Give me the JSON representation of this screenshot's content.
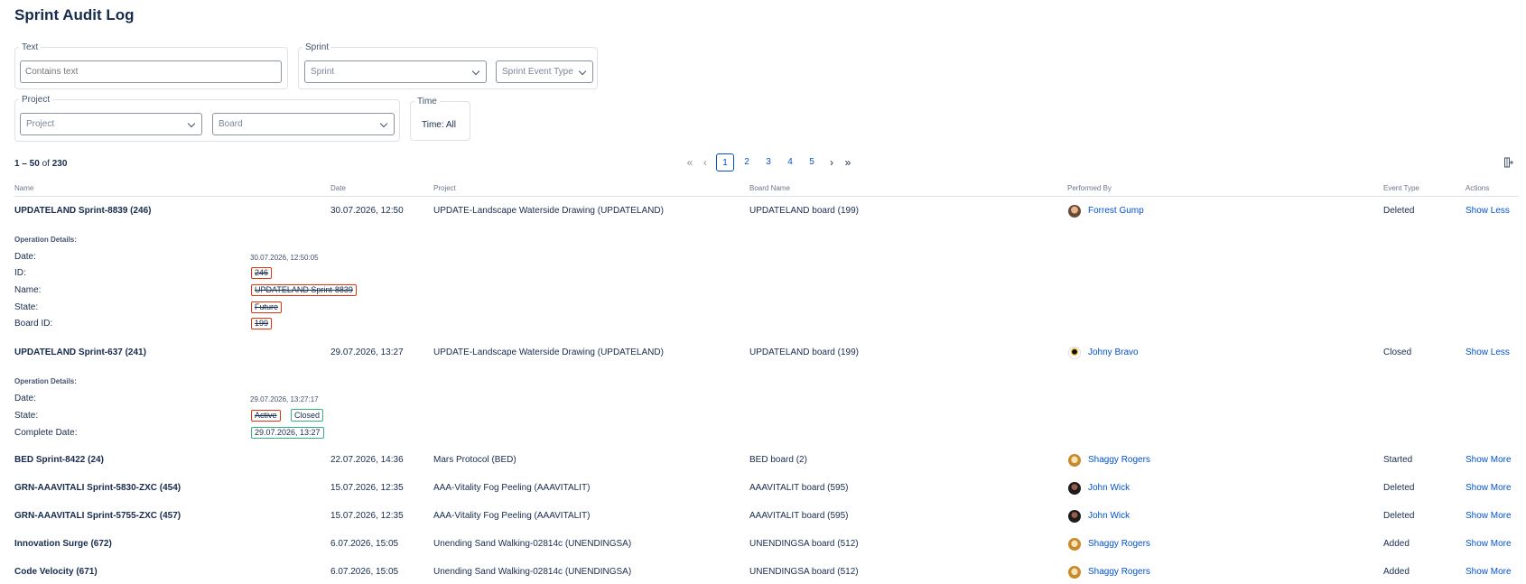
{
  "page": {
    "title": "Sprint Audit Log"
  },
  "filters": {
    "text_group": {
      "legend": "Text",
      "placeholder": "Contains text"
    },
    "sprint_group": {
      "legend": "Sprint",
      "sprint_select": "Sprint",
      "event_type_select": "Sprint Event Type"
    },
    "project_group": {
      "legend": "Project",
      "project_select": "Project",
      "board_select": "Board"
    },
    "time_group": {
      "legend": "Time",
      "value": "Time:  All"
    }
  },
  "pagination": {
    "range": "1 – 50",
    "of": "of",
    "total": "230",
    "first": "«",
    "prev": "‹",
    "next": "›",
    "last": "»",
    "pages": [
      "1",
      "2",
      "3",
      "4",
      "5"
    ],
    "current_page": 1
  },
  "table": {
    "columns": [
      "Name",
      "Date",
      "Project",
      "Board Name",
      "Performed By",
      "Event Type",
      "Actions"
    ],
    "rows": [
      {
        "name": "UPDATELAND Sprint-8839 (246)",
        "date": "30.07.2026, 12:50",
        "project": "UPDATE-Landscape Waterside Drawing (UPDATELAND)",
        "board": "UPDATELAND board (199)",
        "performer": "Forrest Gump",
        "avatar": "forrest",
        "event": "Deleted",
        "action": "Show Less",
        "details": {
          "title": "Operation Details:",
          "date_label": "Date:",
          "date_value": "30.07.2026, 12:50:05",
          "fields": [
            {
              "label": "ID:",
              "removed": "246"
            },
            {
              "label": "Name:",
              "removed": "UPDATELAND Sprint-8839"
            },
            {
              "label": "State:",
              "removed": "Future"
            },
            {
              "label": "Board ID:",
              "removed": "199"
            }
          ]
        }
      },
      {
        "name": "UPDATELAND Sprint-637 (241)",
        "date": "29.07.2026, 13:27",
        "project": "UPDATE-Landscape Waterside Drawing (UPDATELAND)",
        "board": "UPDATELAND board (199)",
        "performer": "Johny Bravo",
        "avatar": "johny",
        "event": "Closed",
        "action": "Show Less",
        "details": {
          "title": "Operation Details:",
          "date_label": "Date:",
          "date_value": "29.07.2026, 13:27:17",
          "fields": [
            {
              "label": "State:",
              "removed": "Active",
              "added": "Closed"
            },
            {
              "label": "Complete Date:",
              "added": "29.07.2026, 13:27"
            }
          ]
        }
      },
      {
        "name": "BED Sprint-8422 (24)",
        "date": "22.07.2026, 14:36",
        "project": "Mars Protocol (BED)",
        "board": "BED board (2)",
        "performer": "Shaggy Rogers",
        "avatar": "shaggy",
        "event": "Started",
        "action": "Show More"
      },
      {
        "name": "GRN-AAAVITALI Sprint-5830-ZXC (454)",
        "date": "15.07.2026, 12:35",
        "project": "AAA-Vitality Fog Peeling (AAAVITALIT)",
        "board": "AAAVITALIT board (595)",
        "performer": "John Wick",
        "avatar": "john",
        "event": "Deleted",
        "action": "Show More"
      },
      {
        "name": "GRN-AAAVITALI Sprint-5755-ZXC (457)",
        "date": "15.07.2026, 12:35",
        "project": "AAA-Vitality Fog Peeling (AAAVITALIT)",
        "board": "AAAVITALIT board (595)",
        "performer": "John Wick",
        "avatar": "john",
        "event": "Deleted",
        "action": "Show More"
      },
      {
        "name": "Innovation Surge (672)",
        "date": "6.07.2026, 15:05",
        "project": "Unending Sand Walking-02814c (UNENDINGSA)",
        "board": "UNENDINGSA board (512)",
        "performer": "Shaggy Rogers",
        "avatar": "shaggy",
        "event": "Added",
        "action": "Show More"
      },
      {
        "name": "Code Velocity (671)",
        "date": "6.07.2026, 15:05",
        "project": "Unending Sand Walking-02814c (UNENDINGSA)",
        "board": "UNENDINGSA board (512)",
        "performer": "Shaggy Rogers",
        "avatar": "shaggy",
        "event": "Added",
        "action": "Show More"
      }
    ]
  }
}
